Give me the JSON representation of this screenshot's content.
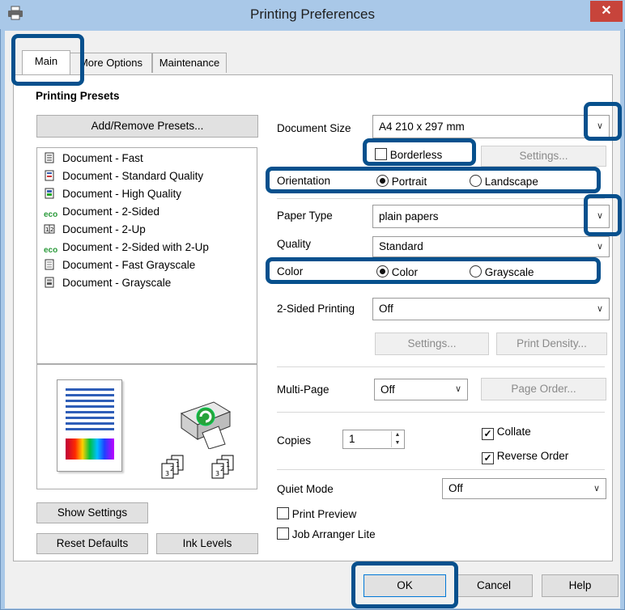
{
  "window": {
    "title": "Printing Preferences",
    "close": "✕"
  },
  "tabs": [
    "Main",
    "More Options",
    "Maintenance"
  ],
  "presets": {
    "heading": "Printing Presets",
    "add_remove": "Add/Remove Presets...",
    "items": [
      {
        "label": "Document - Fast",
        "icon": "document-fast-icon"
      },
      {
        "label": "Document - Standard Quality",
        "icon": "document-standard-icon"
      },
      {
        "label": "Document - High Quality",
        "icon": "document-high-icon"
      },
      {
        "label": "Document - 2-Sided",
        "icon": "eco-icon"
      },
      {
        "label": "Document - 2-Up",
        "icon": "two-up-icon"
      },
      {
        "label": "Document - 2-Sided with 2-Up",
        "icon": "eco-icon"
      },
      {
        "label": "Document - Fast Grayscale",
        "icon": "document-grayscale-icon"
      },
      {
        "label": "Document - Grayscale",
        "icon": "document-grayscale-icon"
      }
    ]
  },
  "settings": {
    "document_size": {
      "label": "Document Size",
      "value": "A4 210 x 297 mm"
    },
    "borderless": {
      "label": "Borderless",
      "checked": false
    },
    "settings_btn": "Settings...",
    "orientation": {
      "label": "Orientation",
      "portrait": "Portrait",
      "landscape": "Landscape",
      "selected": "Portrait"
    },
    "paper_type": {
      "label": "Paper Type",
      "value": "plain papers"
    },
    "quality": {
      "label": "Quality",
      "value": "Standard"
    },
    "color": {
      "label": "Color",
      "color": "Color",
      "grayscale": "Grayscale",
      "selected": "Color"
    },
    "two_sided": {
      "label": "2-Sided Printing",
      "value": "Off"
    },
    "two_sided_settings": "Settings...",
    "print_density": "Print Density...",
    "multi_page": {
      "label": "Multi-Page",
      "value": "Off"
    },
    "page_order": "Page Order...",
    "copies": {
      "label": "Copies",
      "value": "1"
    },
    "collate": {
      "label": "Collate",
      "checked": true
    },
    "reverse_order": {
      "label": "Reverse Order",
      "checked": true
    },
    "quiet_mode": {
      "label": "Quiet Mode",
      "value": "Off"
    },
    "print_preview": {
      "label": "Print Preview",
      "checked": false
    },
    "job_arranger": {
      "label": "Job Arranger Lite",
      "checked": false
    }
  },
  "preview": {
    "page_numbers": [
      "1",
      "2",
      "3"
    ]
  },
  "left_buttons": {
    "show_settings": "Show Settings",
    "reset_defaults": "Reset Defaults",
    "ink_levels": "Ink Levels"
  },
  "dialog_buttons": {
    "ok": "OK",
    "cancel": "Cancel",
    "help": "Help"
  },
  "colors": {
    "highlight": "#07508d",
    "title_bar": "#a9c8e8",
    "close": "#c7443b"
  }
}
